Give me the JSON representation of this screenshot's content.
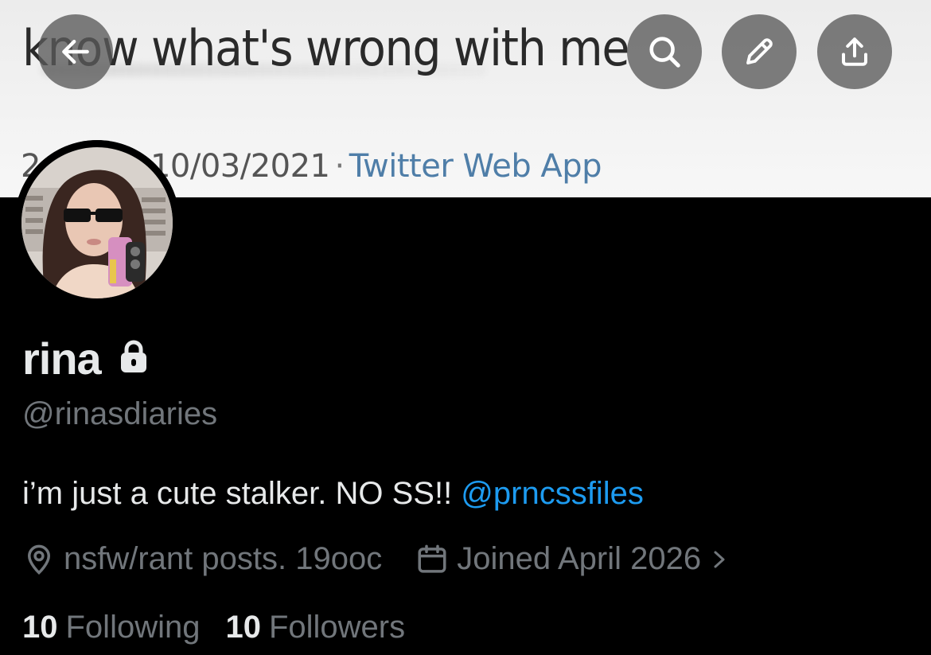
{
  "banner": {
    "tweet_text": "know what's wrong with me",
    "date_partial": "2",
    "date": "10/03/2021",
    "separator": "·",
    "source_app": "Twitter Web App"
  },
  "header_buttons": {
    "back": "back-arrow-icon",
    "search": "search-icon",
    "edit": "pencil-icon",
    "share": "share-icon"
  },
  "profile": {
    "display_name": "rina",
    "protected_icon": "lock-icon",
    "handle": "@rinasdiaries",
    "bio_text": "i’m just a cute stalker. NO SS!! ",
    "bio_mention": "@prncssfiles",
    "location_icon": "location-pin-icon",
    "location": "nsfw/rant posts. 19ooc",
    "joined_icon": "calendar-icon",
    "joined": "Joined April 2026",
    "following_count": "10",
    "following_label": "Following",
    "followers_count": "10",
    "followers_label": "Followers"
  },
  "colors": {
    "background": "#000000",
    "primary_text": "#e7e9ea",
    "secondary_text": "#71767b",
    "link": "#1d9bf0",
    "header_button": "#5a5a5a"
  }
}
